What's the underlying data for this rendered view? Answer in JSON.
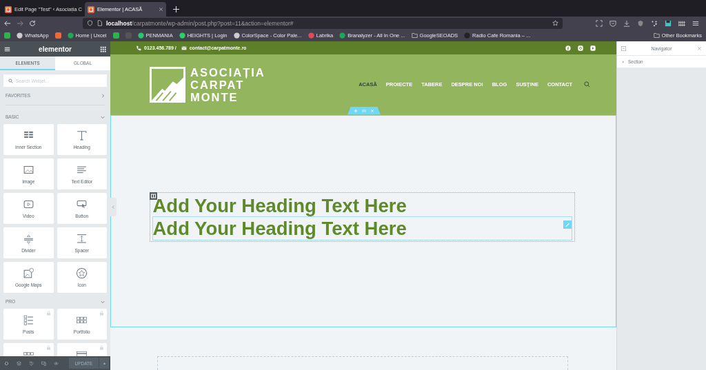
{
  "browser": {
    "tabs": [
      {
        "title": "Edit Page \"Test\" ‹ Asociația C",
        "selected": false
      },
      {
        "title": "Elementor | ACASĂ",
        "selected": true
      }
    ],
    "address": {
      "host": "localhost",
      "path": "/carpatmonte/wp-admin/post.php?post=11&action=elementor#"
    },
    "bookmarks": [
      {
        "kind": "icon"
      },
      {
        "kind": "link",
        "label": "WhatsApp"
      },
      {
        "kind": "icon"
      },
      {
        "kind": "link",
        "label": "Home | Uxcel"
      },
      {
        "kind": "icon"
      },
      {
        "kind": "icon"
      },
      {
        "kind": "link",
        "label": "PENMANIA"
      },
      {
        "kind": "link",
        "label": "HEIGHTS | Login"
      },
      {
        "kind": "link",
        "label": "ColorSpace - Color Pale..."
      },
      {
        "kind": "link",
        "label": "Labrika"
      },
      {
        "kind": "link",
        "label": "Branalyzer - All In One ..."
      },
      {
        "kind": "folder",
        "label": "GoogleSEOADS"
      },
      {
        "kind": "link",
        "label": "Radio Cafe Romania – ..."
      }
    ],
    "other_bookmarks": "Other Bookmarks"
  },
  "panel": {
    "logo": "elementor",
    "tabs": [
      {
        "label": "ELEMENTS",
        "selected": true
      },
      {
        "label": "GLOBAL",
        "selected": false
      }
    ],
    "search": {
      "placeholder": "Search Widget..."
    },
    "categories": [
      {
        "title": "FAVORITES",
        "expanded": false
      },
      {
        "title": "BASIC",
        "expanded": true,
        "widgets": [
          {
            "label": "Inner Section",
            "locked": false
          },
          {
            "label": "Heading",
            "locked": false
          },
          {
            "label": "Image",
            "locked": false
          },
          {
            "label": "Text Editor",
            "locked": false
          },
          {
            "label": "Video",
            "locked": false
          },
          {
            "label": "Button",
            "locked": false
          },
          {
            "label": "Divider",
            "locked": false
          },
          {
            "label": "Spacer",
            "locked": false
          },
          {
            "label": "Google Maps",
            "locked": false
          },
          {
            "label": "Icon",
            "locked": false
          }
        ]
      },
      {
        "title": "PRO",
        "expanded": true,
        "widgets": [
          {
            "label": "Posts",
            "locked": true
          },
          {
            "label": "Portfolio",
            "locked": true
          },
          {
            "locked": true
          },
          {
            "locked": true
          }
        ]
      }
    ],
    "update_button": "UPDATE"
  },
  "site": {
    "phone": "0123.456.789 /",
    "email": "contact@carpatmonte.ro",
    "logo_lines": [
      "ASOCIAȚIA",
      "CARPAT",
      "MONTE"
    ],
    "menu": [
      {
        "label": "ACASĂ",
        "selected": true
      },
      {
        "label": "PROIECTE",
        "selected": false
      },
      {
        "label": "TABERE",
        "selected": false
      },
      {
        "label": "DESPRE NOI",
        "selected": false
      },
      {
        "label": "BLOG",
        "selected": false
      },
      {
        "label": "SUSȚINE",
        "selected": false
      },
      {
        "label": "CONTACT",
        "selected": false
      }
    ],
    "headings": [
      "Add Your Heading Text Here",
      "Add Your Heading Text Here"
    ]
  },
  "navigator": {
    "title": "Navigator",
    "items": [
      {
        "label": "Section",
        "expanded": false
      }
    ]
  }
}
